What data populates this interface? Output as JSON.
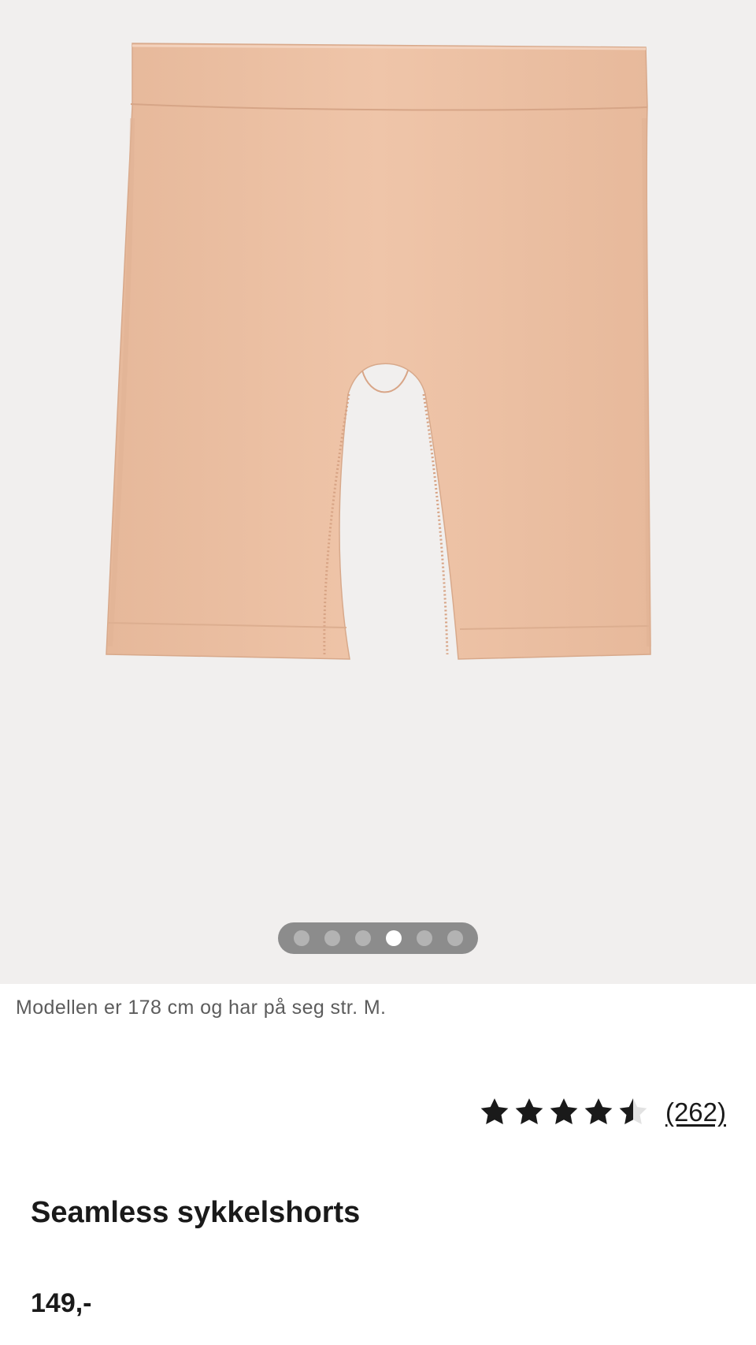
{
  "gallery": {
    "image_alt": "product-image",
    "slide_count": 6,
    "active_slide": 4
  },
  "product": {
    "model_info": "Modellen er 178 cm og har på seg str. M.",
    "rating": 4.5,
    "rating_max": 5,
    "review_count_label": "(262)",
    "title": "Seamless sykkelshorts",
    "price": "149,-"
  },
  "colors": {
    "gallery_bg": "#f1efee",
    "product_color": "#ebbd9f",
    "text": "#1a1a1a"
  }
}
